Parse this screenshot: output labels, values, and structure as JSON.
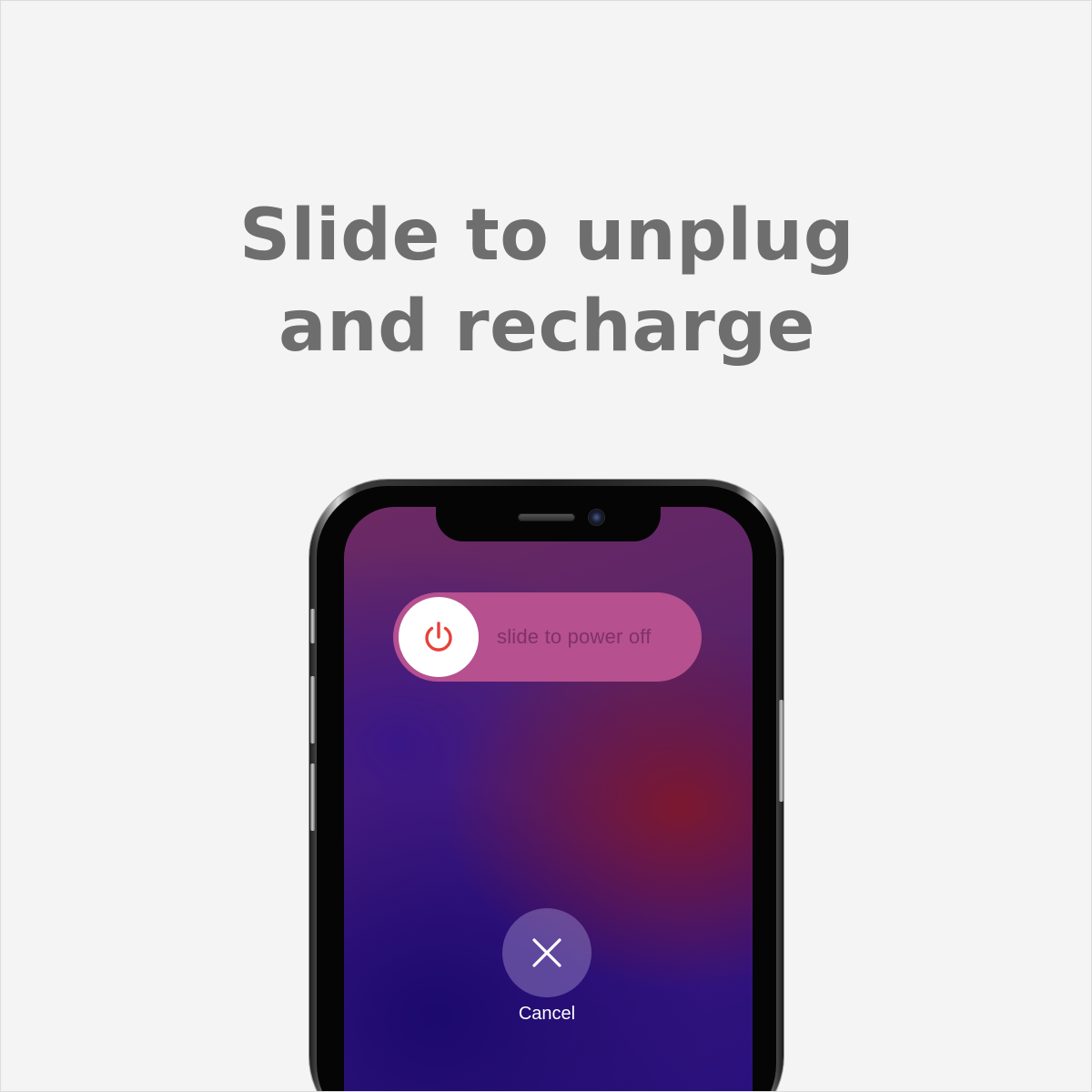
{
  "headline": {
    "line1": "Slide to unplug",
    "line2": "and recharge"
  },
  "power_slider": {
    "label": "slide to power off",
    "icon": "power-icon",
    "accent_color": "#e8413a"
  },
  "cancel": {
    "label": "Cancel",
    "icon": "close-icon"
  },
  "colors": {
    "background": "#f4f4f4",
    "headline": "#6e6e6e",
    "slider_track": "#b6508f"
  }
}
